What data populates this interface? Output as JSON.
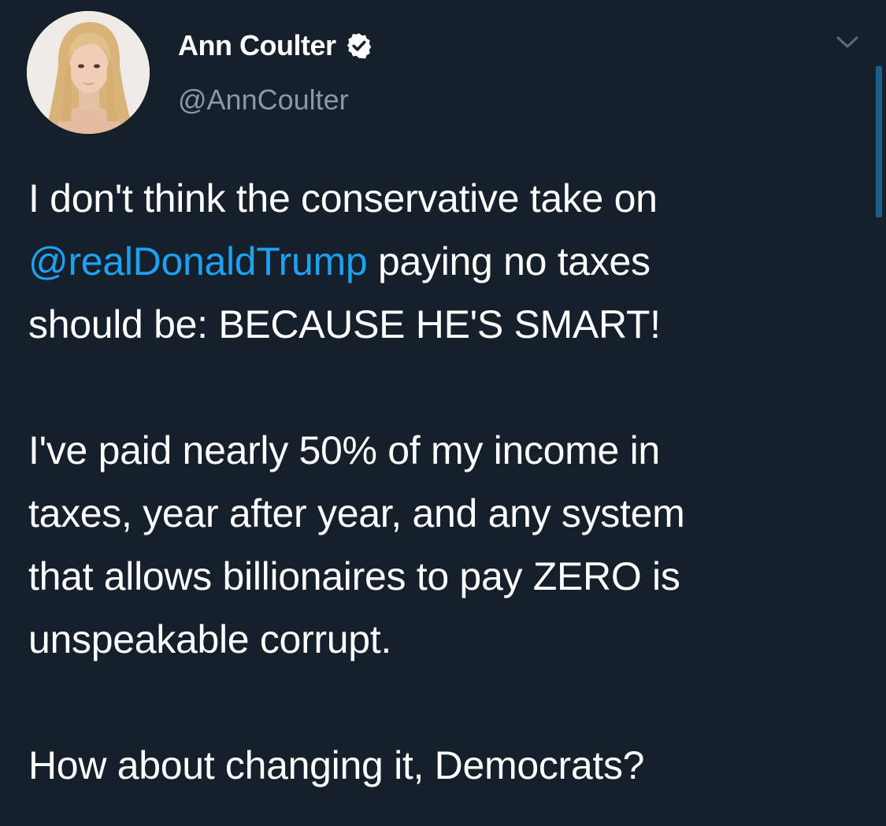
{
  "tweet": {
    "author": {
      "display_name": "Ann Coulter",
      "handle": "@AnnCoulter",
      "verified_icon": "verified-badge-icon",
      "avatar": "profile-photo"
    },
    "menu_icon": "chevron-down-icon",
    "body": {
      "line1a": "I don't think the conservative take on",
      "mention": "@realDonaldTrump",
      "line2b": " paying no taxes",
      "line3": "should be: BECAUSE HE'S SMART!",
      "line4": "I've paid nearly 50% of my income in",
      "line5": "taxes, year after year, and any system",
      "line6": "that allows billionaires to pay ZERO is",
      "line7": "unspeakable corrupt.",
      "line8": "How about changing it, Democrats?"
    },
    "colors": {
      "background": "#15202b",
      "text": "#ffffff",
      "secondary_text": "#8899a6",
      "link": "#1da1f2"
    }
  }
}
